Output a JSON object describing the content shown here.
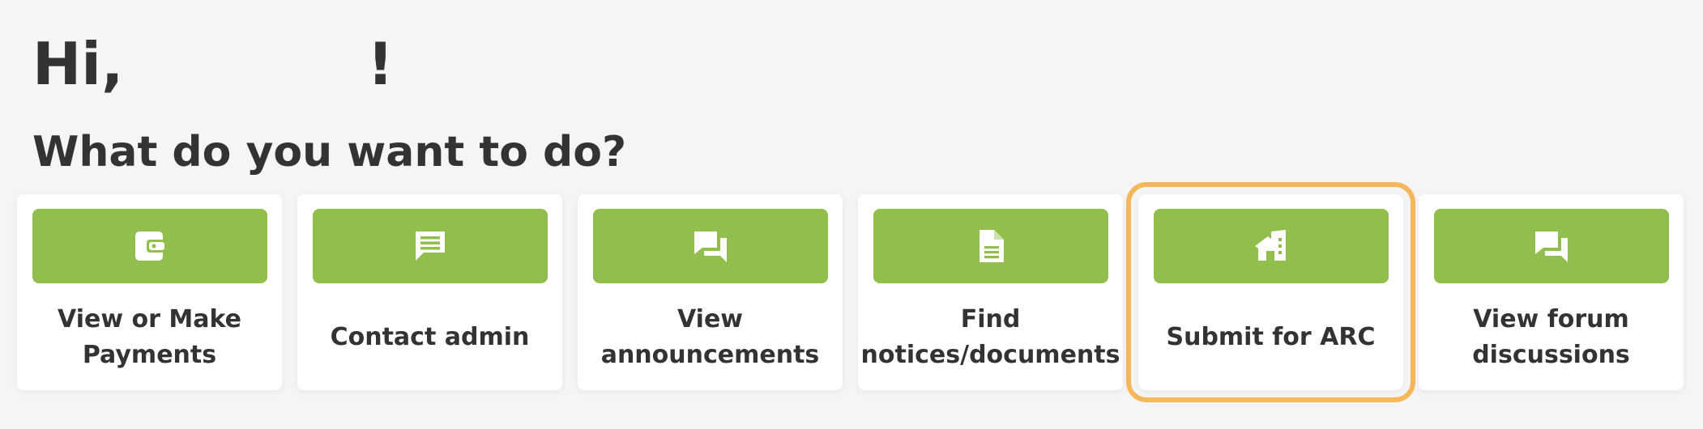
{
  "greeting": {
    "text": "Hi,            !"
  },
  "question": "What do you want to do?",
  "accent_color": "#92be4e",
  "highlight_color": "#f4b85a",
  "actions": [
    {
      "label": "View or Make Payments",
      "icon": "wallet-icon"
    },
    {
      "label": "Contact admin",
      "icon": "message-icon"
    },
    {
      "label": "View announcements",
      "icon": "chat-bubbles-icon"
    },
    {
      "label": "Find notices/documents",
      "icon": "document-icon"
    },
    {
      "label": "Submit for ARC",
      "icon": "house-icon",
      "highlighted": true
    },
    {
      "label": "View forum discussions",
      "icon": "chat-bubbles-icon"
    }
  ]
}
